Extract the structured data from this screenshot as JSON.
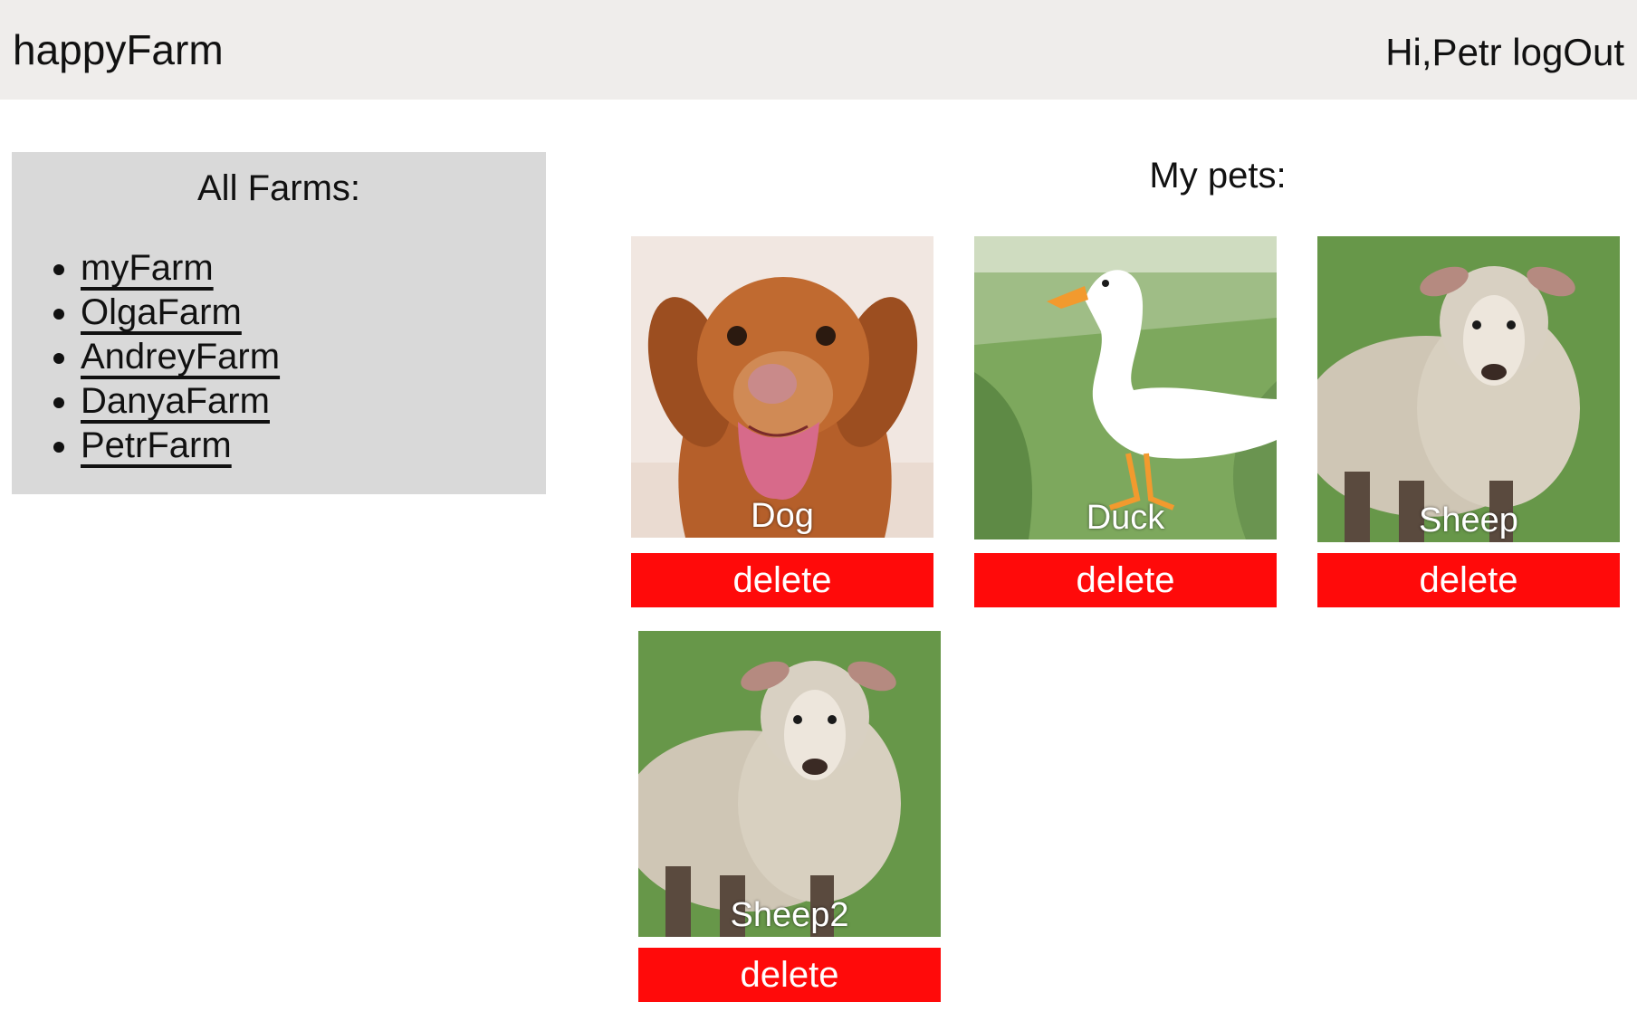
{
  "header": {
    "brand": "happyFarm",
    "greeting": "Hi,Petr",
    "logout_label": "logOut"
  },
  "farms": {
    "title": "All Farms:",
    "items": [
      {
        "label": "myFarm"
      },
      {
        "label": "OlgaFarm"
      },
      {
        "label": "AndreyFarm"
      },
      {
        "label": "DanyaFarm"
      },
      {
        "label": "PetrFarm"
      }
    ]
  },
  "pets": {
    "title": "My pets:",
    "items": [
      {
        "name": "Dog",
        "delete_label": "delete",
        "photo": "dog"
      },
      {
        "name": "Duck",
        "delete_label": "delete",
        "photo": "duck"
      },
      {
        "name": "Sheep",
        "delete_label": "delete",
        "photo": "sheep"
      },
      {
        "name": "Sheep2",
        "delete_label": "delete",
        "photo": "sheep"
      }
    ]
  },
  "colors": {
    "header_bg": "#efedeb",
    "sidebar_bg": "#d9d9d9",
    "delete_button": "#ff0a0a"
  }
}
